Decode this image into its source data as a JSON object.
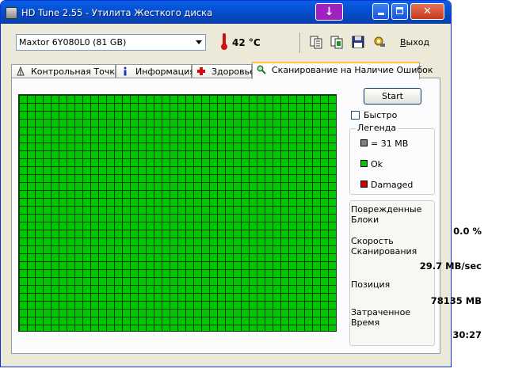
{
  "window": {
    "title": "HD Tune 2.55 - Утилита Жесткого диска",
    "extra_button_glyph": "↓",
    "minimize_label": "",
    "maximize_label": "",
    "close_label": "✕"
  },
  "toolbar": {
    "drive": "Maxtor 6Y080L0 (81 GB)",
    "temperature": "42 °C",
    "exit_label_underlined": "В",
    "exit_label_rest": "ыход",
    "icons": [
      "copy-text-icon",
      "copy-screenshot-icon",
      "save-icon",
      "options-icon"
    ]
  },
  "tabs": [
    {
      "label": "Контрольная Точка",
      "icon": "benchmark-icon"
    },
    {
      "label": "Информация",
      "icon": "info-icon"
    },
    {
      "label": "Здоровье",
      "icon": "health-cross-icon"
    },
    {
      "label": "Сканирование на Наличие Ошибок",
      "icon": "magnifier-icon",
      "active": true
    }
  ],
  "scan": {
    "start_label": "Start",
    "quick_label": "Быстро",
    "quick_checked": false,
    "block_color": "#00c800",
    "legend": {
      "title": "Легенда",
      "items": [
        {
          "label": "= 31 MB",
          "color": "#808080"
        },
        {
          "label": "Ok",
          "color": "#00c800"
        },
        {
          "label": "Damaged",
          "color": "#d00000"
        }
      ]
    },
    "stats": {
      "damaged_label": "Поврежденные Блоки",
      "damaged_value": "0.0 %",
      "speed_label": "Скорость Сканирования",
      "speed_value": "29.7 MB/sec",
      "position_label": "Позиция",
      "position_value": "78135 MB",
      "elapsed_label": "Затраченное Время",
      "elapsed_value": "30:27"
    }
  }
}
